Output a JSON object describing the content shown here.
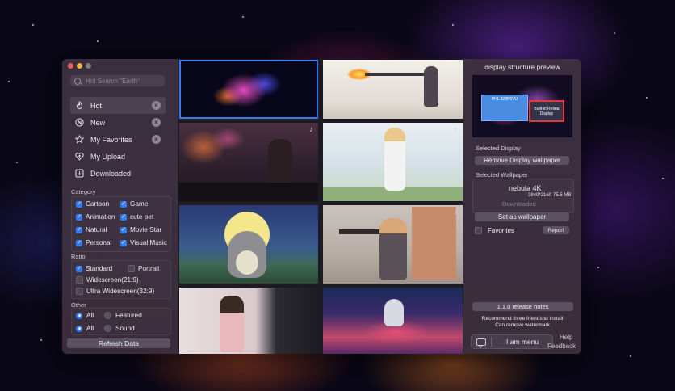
{
  "search": {
    "placeholder": "Hot Search \"Earth\""
  },
  "nav": [
    {
      "key": "hot",
      "label": "Hot",
      "icon": "flame-icon",
      "active": true,
      "clearable": true
    },
    {
      "key": "new",
      "label": "New",
      "icon": "n-circle-icon",
      "active": false,
      "clearable": true
    },
    {
      "key": "favorites",
      "label": "My Favorites",
      "icon": "star-icon",
      "active": false,
      "clearable": true
    },
    {
      "key": "upload",
      "label": "My Upload",
      "icon": "heart-upload-icon",
      "active": false,
      "clearable": false
    },
    {
      "key": "downloaded",
      "label": "Downloaded",
      "icon": "download-icon",
      "active": false,
      "clearable": false
    }
  ],
  "category": {
    "title": "Category",
    "items": [
      {
        "label": "Cartoon",
        "checked": true
      },
      {
        "label": "Game",
        "checked": true
      },
      {
        "label": "Animation",
        "checked": true
      },
      {
        "label": "cute pet",
        "checked": true
      },
      {
        "label": "Natural",
        "checked": true
      },
      {
        "label": "Movie Star",
        "checked": true
      },
      {
        "label": "Personal",
        "checked": true
      },
      {
        "label": "Visual Music",
        "checked": true
      }
    ]
  },
  "ratio": {
    "title": "Ratio",
    "items": [
      {
        "label": "Standard",
        "checked": true
      },
      {
        "label": "Portrait",
        "checked": false
      },
      {
        "label": "Widescreen(21:9)",
        "checked": false
      },
      {
        "label": "Ultra Widescreen(32:9)",
        "checked": false
      }
    ]
  },
  "other": {
    "title": "Other",
    "rows": [
      [
        {
          "label": "All",
          "selected": true
        },
        {
          "label": "Featured",
          "selected": false
        }
      ],
      [
        {
          "label": "All",
          "selected": true
        },
        {
          "label": "Sound",
          "selected": false
        }
      ]
    ]
  },
  "refresh_label": "Refresh Data",
  "panel": {
    "title": "display structure preview",
    "display1_label": "PHL 328P6VU",
    "display2_label": "Built-in Retina Display",
    "selected_display_label": "Selected Display",
    "remove_button": "Remove Display wallpaper",
    "selected_wallpaper_label": "Selected Wallpaper",
    "wallpaper": {
      "name": "nebula 4K",
      "resolution": "3840*2160",
      "size": "75.5 MB",
      "status": "Downloaded"
    },
    "set_button": "Set as wallpaper",
    "favorites_label": "Favorites",
    "report_button": "Report",
    "release_notes": "1.1.0 release notes",
    "recommend_line1": "Recommend three friends to install",
    "recommend_line2": "Can remove watermark",
    "menu_button": "I am menu",
    "help_link": "Help",
    "feedback_link": "Feedback"
  },
  "colors": {
    "accent": "#2f7cf6",
    "selected_display_border": "#e33b3b"
  }
}
